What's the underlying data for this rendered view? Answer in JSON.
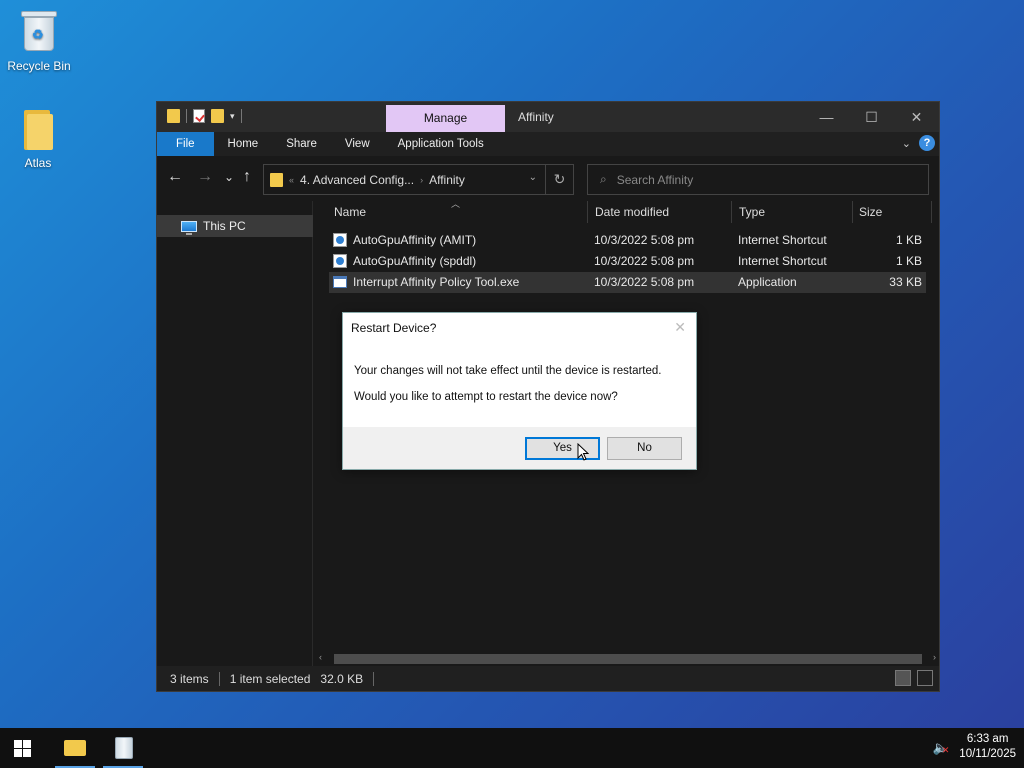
{
  "desktop": {
    "icons": [
      {
        "label": "Recycle Bin",
        "icon": "recycle-bin-icon"
      },
      {
        "label": "Atlas",
        "icon": "folder-icon"
      }
    ]
  },
  "explorer": {
    "manage_tab": "Manage",
    "title": "Affinity",
    "window_buttons": {
      "minimize": "—",
      "maximize": "☐",
      "close": "✕"
    },
    "ribbon_tabs": [
      "File",
      "Home",
      "Share",
      "View",
      "Application Tools"
    ],
    "nav": {
      "back": "←",
      "forward": "→",
      "recent": "⌄",
      "up": "↑"
    },
    "address": {
      "crumb_prefix": "«",
      "crumbs": [
        "4. Advanced Config...",
        "Affinity"
      ],
      "separator": "›"
    },
    "search_placeholder": "Search Affinity",
    "nav_pane": {
      "items": [
        "This PC"
      ]
    },
    "columns": [
      "Name",
      "Date modified",
      "Type",
      "Size"
    ],
    "files": [
      {
        "name": "AutoGpuAffinity (AMIT)",
        "date": "10/3/2022 5:08 pm",
        "type": "Internet Shortcut",
        "size": "1 KB",
        "icon": "internet-shortcut-icon",
        "selected": false
      },
      {
        "name": "AutoGpuAffinity (spddl)",
        "date": "10/3/2022 5:08 pm",
        "type": "Internet Shortcut",
        "size": "1 KB",
        "icon": "internet-shortcut-icon",
        "selected": false
      },
      {
        "name": "Interrupt Affinity Policy Tool.exe",
        "date": "10/3/2022 5:08 pm",
        "type": "Application",
        "size": "33 KB",
        "icon": "application-icon",
        "selected": true
      }
    ],
    "status": {
      "items": "3 items",
      "selected": "1 item selected",
      "size": "32.0 KB"
    }
  },
  "dialog": {
    "title": "Restart Device?",
    "line1": "Your changes will not take effect until the device is restarted.",
    "line2": "Would you like to attempt to restart the device now?",
    "yes": "Yes",
    "no": "No"
  },
  "taskbar": {
    "time": "6:33 am",
    "date": "10/11/2025"
  },
  "colors": {
    "accent": "#1979ca",
    "manage_tab": "#e2c7f5",
    "desktop_start": "#1f8fd8",
    "desktop_end": "#2b3f9e"
  }
}
